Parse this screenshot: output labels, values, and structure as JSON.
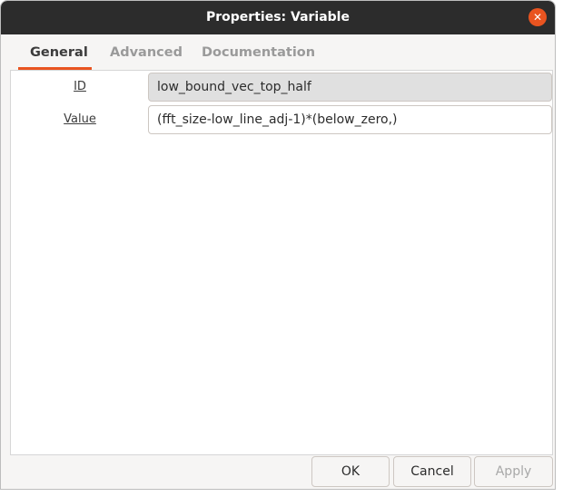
{
  "window": {
    "title": "Properties: Variable",
    "close_glyph": "✕"
  },
  "tabs": [
    {
      "label": "General",
      "active": true
    },
    {
      "label": "Advanced",
      "active": false
    },
    {
      "label": "Documentation",
      "active": false
    }
  ],
  "general": {
    "id_label": "ID",
    "id_value": "low_bound_vec_top_half",
    "value_label": "Value",
    "value_value": "(fft_size-low_line_adj-1)*(below_zero,)"
  },
  "buttons": {
    "ok": "OK",
    "cancel": "Cancel",
    "apply": "Apply"
  },
  "colors": {
    "accent": "#e95420",
    "titlebar": "#2c2c2c"
  }
}
